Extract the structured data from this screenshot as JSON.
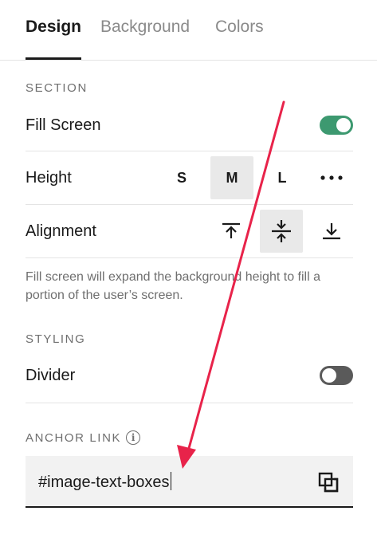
{
  "tabs": [
    {
      "label": "Design",
      "active": true
    },
    {
      "label": "Background",
      "active": false
    },
    {
      "label": "Colors",
      "active": false
    }
  ],
  "section": {
    "heading": "SECTION",
    "fill_screen": {
      "label": "Fill Screen",
      "enabled": true
    },
    "height": {
      "label": "Height",
      "options": [
        "S",
        "M",
        "L"
      ],
      "selected": "M",
      "more_icon": "more-horizontal-icon"
    },
    "alignment": {
      "label": "Alignment",
      "options": [
        "align-top-icon",
        "align-center-icon",
        "align-bottom-icon"
      ],
      "selected": "align-center-icon"
    },
    "helper_text": "Fill screen will expand the background height to fill a portion of the user’s screen."
  },
  "styling": {
    "heading": "STYLING",
    "divider": {
      "label": "Divider",
      "enabled": false
    }
  },
  "anchor": {
    "heading": "ANCHOR LINK",
    "info_icon": "info-icon",
    "value": "#image-text-boxes",
    "copy_icon": "copy-icon"
  },
  "colors": {
    "toggle_on": "#3d9970",
    "toggle_off": "#5a5a5a",
    "annotation_arrow": "#e8234a",
    "selected_bg": "#e9e9e9"
  }
}
